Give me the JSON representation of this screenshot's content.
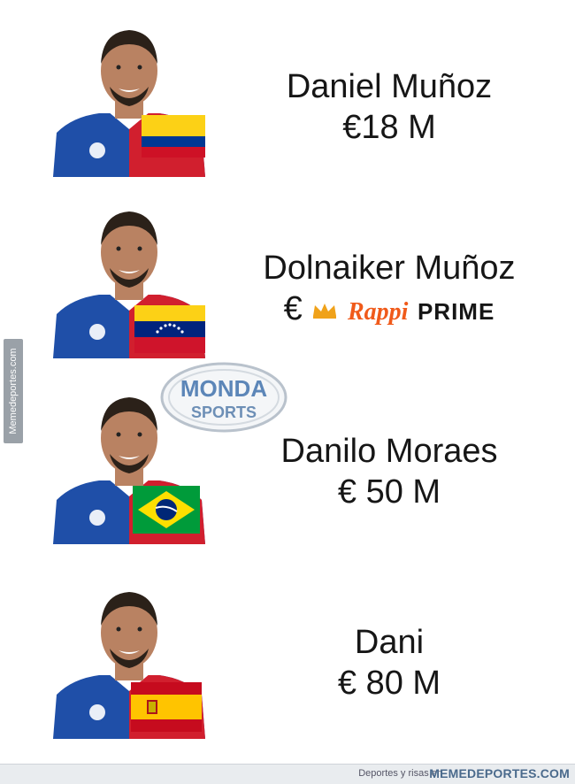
{
  "watermark_side": "Memedeportes.com",
  "rows": [
    {
      "name": "Daniel Muñoz",
      "price": "€18 M",
      "flag": "colombia-flag"
    },
    {
      "name": "Dolnaiker Muñoz",
      "price_symbol": "€",
      "brand_word": "Rappi",
      "brand_suffix": "PRIME",
      "flag": "venezuela-flag"
    },
    {
      "name": "Danilo Moraes",
      "price": "€ 50 M",
      "flag": "brazil-flag"
    },
    {
      "name": "Dani",
      "price": "€ 80 M",
      "flag": "spain-flag"
    }
  ],
  "badge": {
    "top": "MONDA",
    "bottom": "SPORTS"
  },
  "footer": {
    "tagline": "Deportes y risas en",
    "site": "MEMEDEPORTES.COM"
  },
  "colors": {
    "jersey_blue": "#1f4fa8",
    "jersey_red": "#d11f2e",
    "skin": "#b98262",
    "rappi_orange": "#f05a1a"
  }
}
